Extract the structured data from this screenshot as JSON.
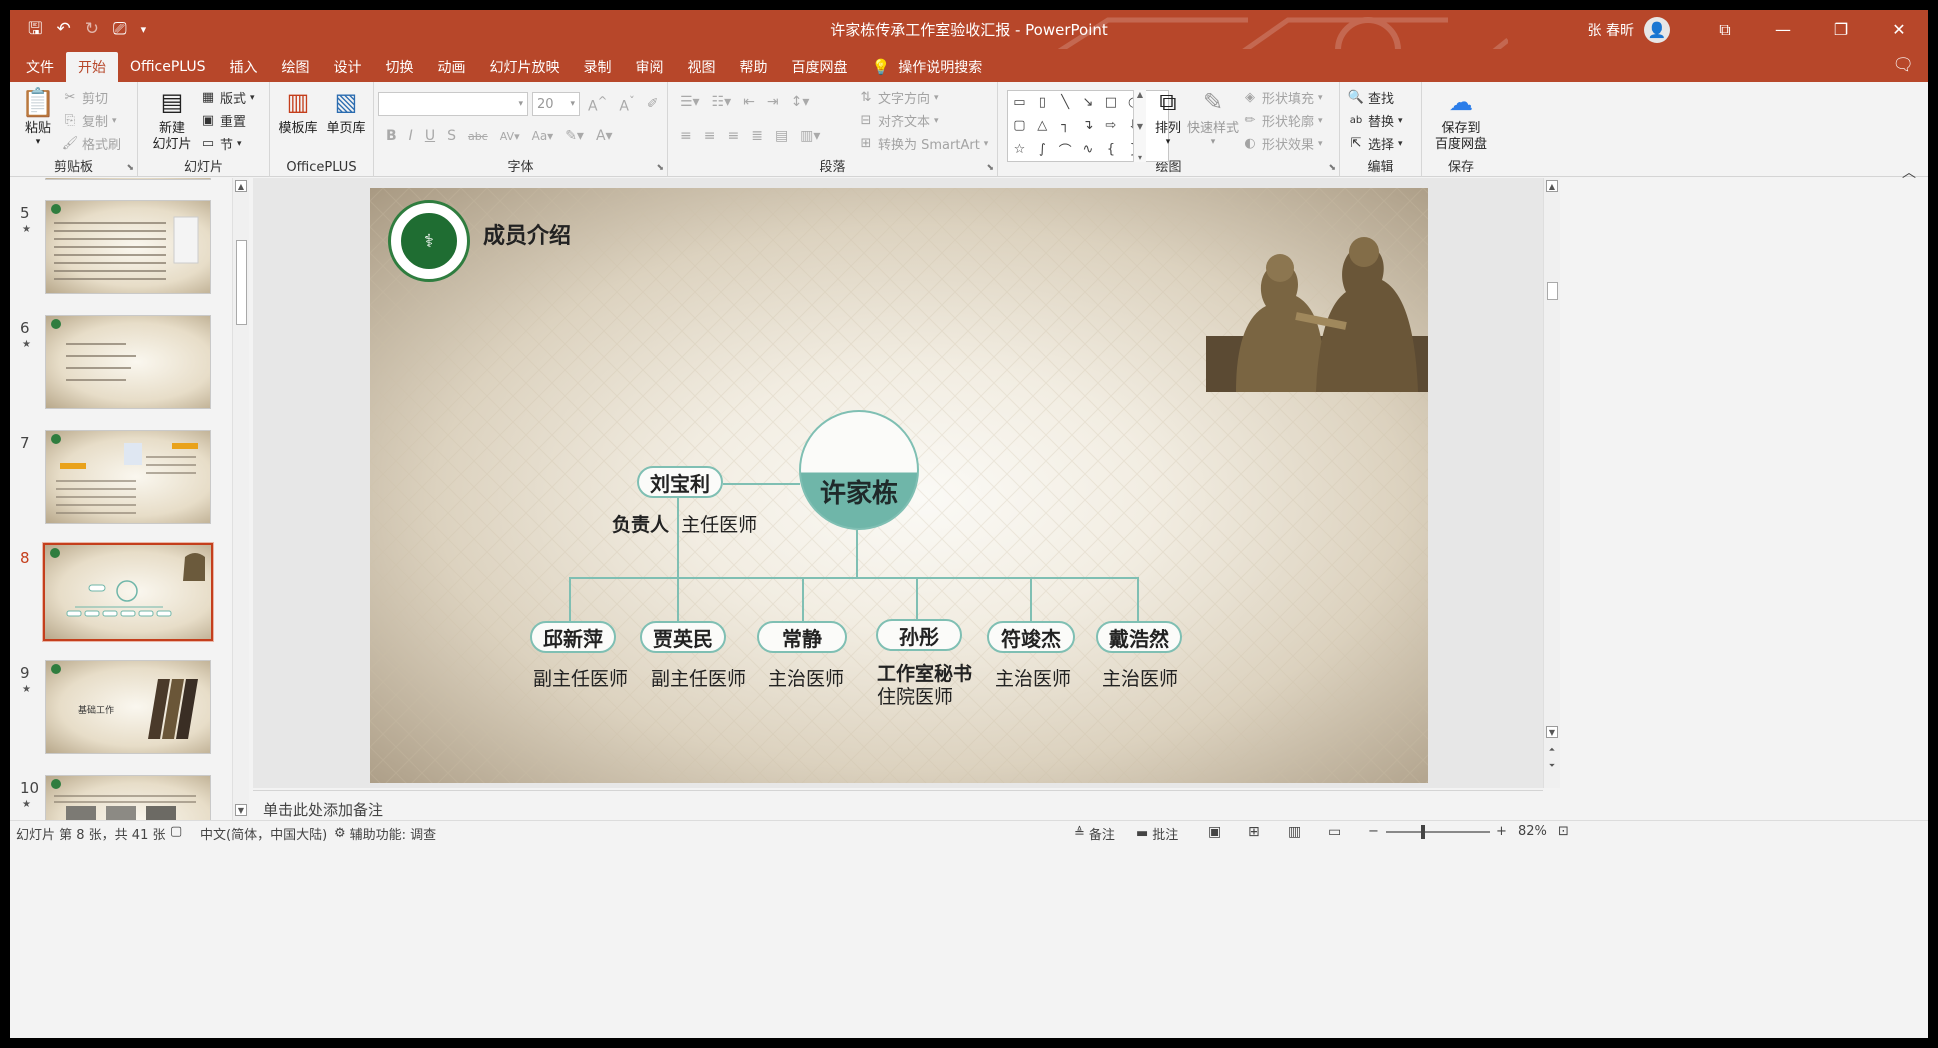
{
  "window": {
    "title": "许家栋传承工作室验收汇报  -  PowerPoint",
    "user": "张 春昕"
  },
  "tabs": [
    "文件",
    "开始",
    "OfficePLUS",
    "插入",
    "绘图",
    "设计",
    "切换",
    "动画",
    "幻灯片放映",
    "录制",
    "审阅",
    "视图",
    "帮助",
    "百度网盘"
  ],
  "tell_me": "操作说明搜索",
  "ribbon": {
    "clipboard": {
      "label": "剪贴板",
      "paste": "粘贴",
      "cut": "剪切",
      "copy": "复制",
      "format_painter": "格式刷"
    },
    "slides": {
      "label": "幻灯片",
      "new_slide": "新建\n幻灯片",
      "layout": "版式",
      "reset": "重置",
      "section": "节"
    },
    "officeplus": {
      "label": "OfficePLUS",
      "templates": "模板库",
      "single": "单页库"
    },
    "font": {
      "label": "字体",
      "font_name": "",
      "font_size": "20"
    },
    "paragraph": {
      "label": "段落",
      "text_direction": "文字方向",
      "align_text": "对齐文本",
      "smartart": "转换为 SmartArt"
    },
    "drawing": {
      "label": "绘图",
      "arrange": "排列",
      "quick_styles": "快速样式",
      "shape_fill": "形状填充",
      "shape_outline": "形状轮廓",
      "shape_effects": "形状效果"
    },
    "editing": {
      "label": "编辑",
      "find": "查找",
      "replace": "替换",
      "select": "选择"
    },
    "save": {
      "label": "保存",
      "save_to_baidu": "保存到\n百度网盘"
    }
  },
  "thumbnails": [
    {
      "num": "5",
      "star": "★",
      "selected": false
    },
    {
      "num": "6",
      "star": "★",
      "selected": false
    },
    {
      "num": "7",
      "star": "",
      "selected": false
    },
    {
      "num": "8",
      "star": "",
      "selected": true
    },
    {
      "num": "9",
      "star": "★",
      "selected": false,
      "title": "基础工作"
    },
    {
      "num": "10",
      "star": "★",
      "selected": false
    }
  ],
  "slide": {
    "title": "成员介绍",
    "leader_main": "许家栋",
    "second": {
      "name": "刘宝利",
      "role_bold": "负责人",
      "role": "主任医师"
    },
    "members": [
      {
        "name": "邱新萍",
        "role": "副主任医师"
      },
      {
        "name": "贾英民",
        "role": "副主任医师"
      },
      {
        "name": "常静",
        "role": "主治医师"
      },
      {
        "name": "孙彤",
        "role_bold": "工作室秘书",
        "role": "住院医师"
      },
      {
        "name": "符竣杰",
        "role": "主治医师"
      },
      {
        "name": "戴浩然",
        "role": "主治医师"
      }
    ]
  },
  "notes_placeholder": "单击此处添加备注",
  "status": {
    "slide_info": "幻灯片 第 8 张，共 41 张",
    "language": "中文(简体，中国大陆)",
    "accessibility": "辅助功能: 调查",
    "notes": "备注",
    "comments": "批注",
    "zoom": "82%"
  },
  "colors": {
    "accent": "#b7472a",
    "teal": "#7fbfb3",
    "teal_fill": "#6fb6a9",
    "selected": "#c43e1c"
  }
}
